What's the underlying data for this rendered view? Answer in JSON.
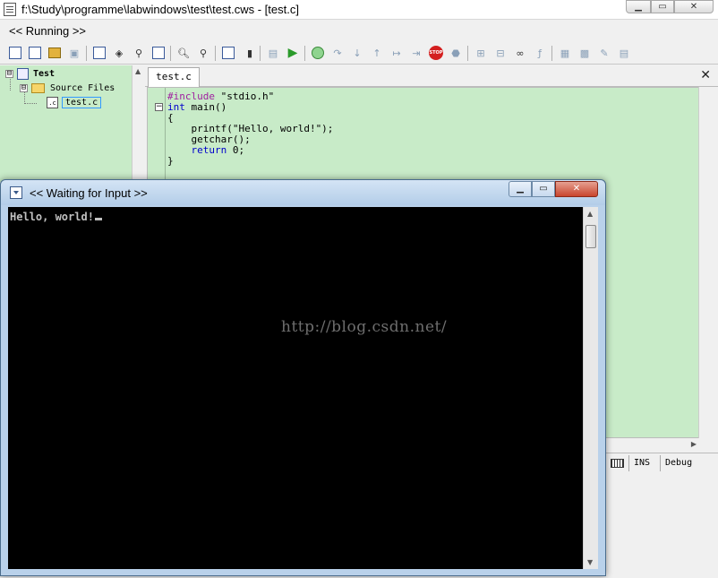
{
  "window": {
    "title": "f:\\Study\\programme\\labwindows\\test\\test.cws - [test.c]",
    "min_glyph": "▁",
    "max_glyph": "▭",
    "close_glyph": "✕"
  },
  "menubar": {
    "running_label": "<< Running >>"
  },
  "toolbar": {
    "stop_label": "STOP",
    "go_label": "GO"
  },
  "project_tree": {
    "project_name": "Test",
    "folder_name": "Source Files",
    "file_name": "test.c",
    "file_icon_label": ".c",
    "expand_glyph": "⊟"
  },
  "editor": {
    "tab_label": "test.c",
    "close_glyph": "✕",
    "code": {
      "line1_directive": "#include",
      "line1_rest": " \"stdio.h\"",
      "line2_kw": "int",
      "line2_rest": " main()",
      "line3": "{",
      "line4": "    printf(\"Hello, world!\");",
      "line5": "    getchar();",
      "line6_kw": "    return",
      "line6_rest": " 0;",
      "line7": "}"
    }
  },
  "statusbar": {
    "ins": "INS",
    "mode": "Debug"
  },
  "console": {
    "title": "<< Waiting for Input >>",
    "output": "Hello, world!",
    "watermark": "http://blog.csdn.net/"
  },
  "colors": {
    "editor_bg": "#c8ebc8",
    "directive": "#a020a0",
    "keyword": "#0000cc",
    "console_bg": "#000000",
    "console_text": "#c0c0c0"
  }
}
